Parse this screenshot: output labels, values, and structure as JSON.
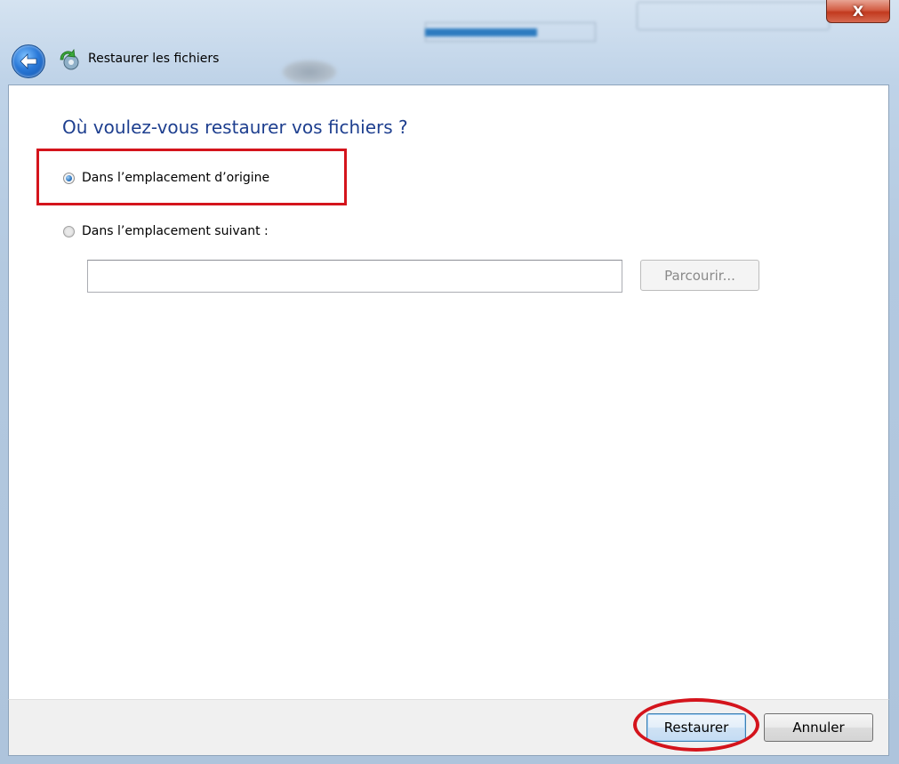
{
  "window": {
    "close_glyph": "X",
    "close_icon": "close-icon"
  },
  "nav": {
    "back_icon": "back-arrow-icon",
    "app_icon": "restore-files-icon",
    "title": "Restaurer les fichiers"
  },
  "main": {
    "question": "Où voulez-vous restaurer vos fichiers ?",
    "options": [
      {
        "label": "Dans l’emplacement d’origine",
        "checked": true
      },
      {
        "label": "Dans l’emplacement suivant :",
        "checked": false
      }
    ],
    "path_input": {
      "value": "",
      "placeholder": ""
    },
    "browse_label": "Parcourir..."
  },
  "footer": {
    "restore_label": "Restaurer",
    "cancel_label": "Annuler"
  },
  "colors": {
    "heading": "#1e3f8f",
    "annotation": "#d4141c"
  }
}
